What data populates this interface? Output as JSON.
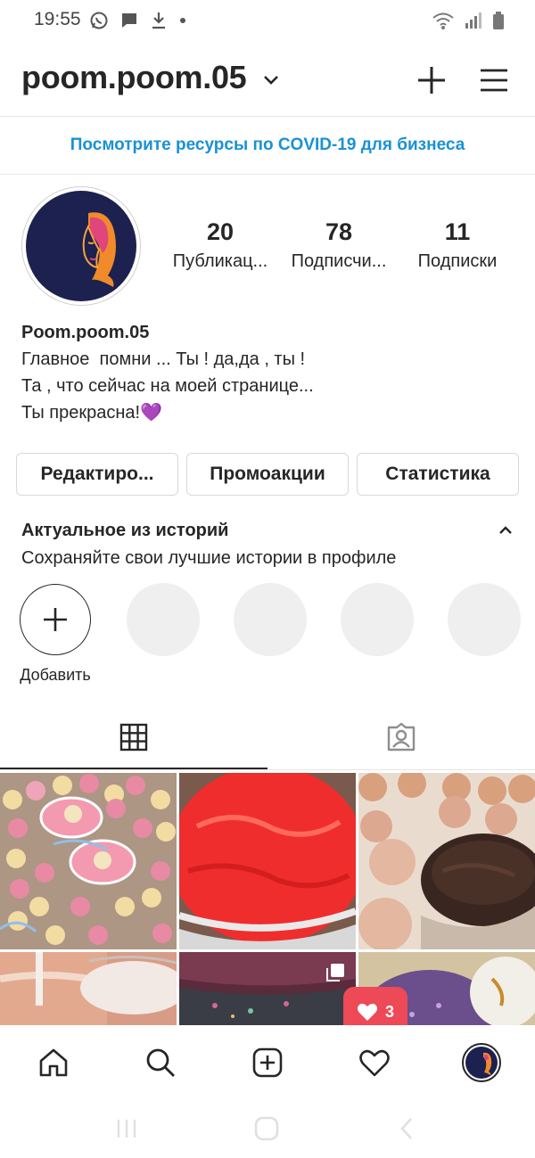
{
  "status_bar": {
    "time": "19:55"
  },
  "header": {
    "username": "poom.poom.05"
  },
  "banner": {
    "text": "Посмотрите ресурсы по COVID-19 для бизнеса"
  },
  "stats": [
    {
      "value": "20",
      "label": "Публикац..."
    },
    {
      "value": "78",
      "label": "Подписчи..."
    },
    {
      "value": "11",
      "label": "Подписки"
    }
  ],
  "bio": {
    "name": "Poom.poom.05",
    "line1": "Главное  помни ... Ты ! да,да , ты !",
    "line2": "Та , что сейчас на моей странице...",
    "line3": "Ты прекрасна!💜"
  },
  "buttons": {
    "edit": "Редактиро...",
    "promo": "Промоакции",
    "stats": "Статистика"
  },
  "highlights": {
    "title": "Актуальное из историй",
    "subtitle": "Сохраняйте свои лучшие истории в профиле",
    "add_label": "Добавить"
  },
  "notification": {
    "likes_count": "3"
  },
  "colors": {
    "accent_blue": "#1991d6",
    "like_red": "#ed4956",
    "avatar_bg": "#1c2150"
  }
}
